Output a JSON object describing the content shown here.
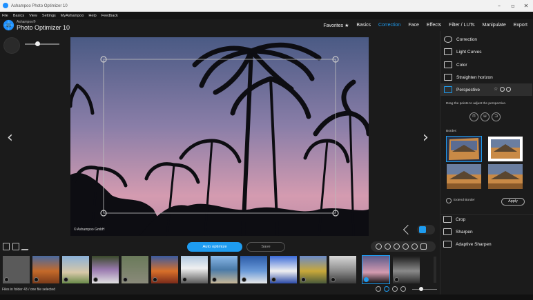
{
  "window": {
    "title": "Ashampoo Photo Optimizer 10"
  },
  "menu": [
    "File",
    "Basics",
    "View",
    "Settings",
    "MyAshampoo",
    "Help",
    "Feedback"
  ],
  "header": {
    "brand_small": "Ashampoo®",
    "brand": "Photo Optimizer 10",
    "tabs": [
      {
        "label": "Favorites ★",
        "active": false
      },
      {
        "label": "Basics",
        "active": false
      },
      {
        "label": "Correction",
        "active": true
      },
      {
        "label": "Face",
        "active": false
      },
      {
        "label": "Effects",
        "active": false
      },
      {
        "label": "Filter / LUTs",
        "active": false
      },
      {
        "label": "Manipulate",
        "active": false
      },
      {
        "label": "Export",
        "active": false
      }
    ]
  },
  "viewer": {
    "copyright": "© Ashampoo GmbH"
  },
  "right_panel": {
    "items_top": [
      {
        "label": "Correction",
        "icon": "sun-icon"
      },
      {
        "label": "Light Curves",
        "icon": "curve-icon"
      },
      {
        "label": "Color",
        "icon": "palette-icon"
      },
      {
        "label": "Straighten horizon",
        "icon": "horizon-icon"
      },
      {
        "label": "Perspective",
        "icon": "perspective-icon",
        "active": true
      }
    ],
    "perspective_hint": "Drag the points to adjust the perspective.",
    "border_label": "Border:",
    "extend_border_label": "Extend Border",
    "apply_label": "Apply",
    "items_bottom": [
      {
        "label": "Crop",
        "icon": "crop-icon"
      },
      {
        "label": "Sharpen",
        "icon": "triangle-icon"
      },
      {
        "label": "Adaptive Sharpen",
        "icon": "triangle-icon"
      }
    ]
  },
  "toolbar": {
    "auto_optimize_label": "Auto optimize",
    "save_label": "Save"
  },
  "status": {
    "text": "Files in folder 43 / one file selected"
  },
  "colors": {
    "accent": "#1e9cf0",
    "background": "#1b1b1b"
  }
}
